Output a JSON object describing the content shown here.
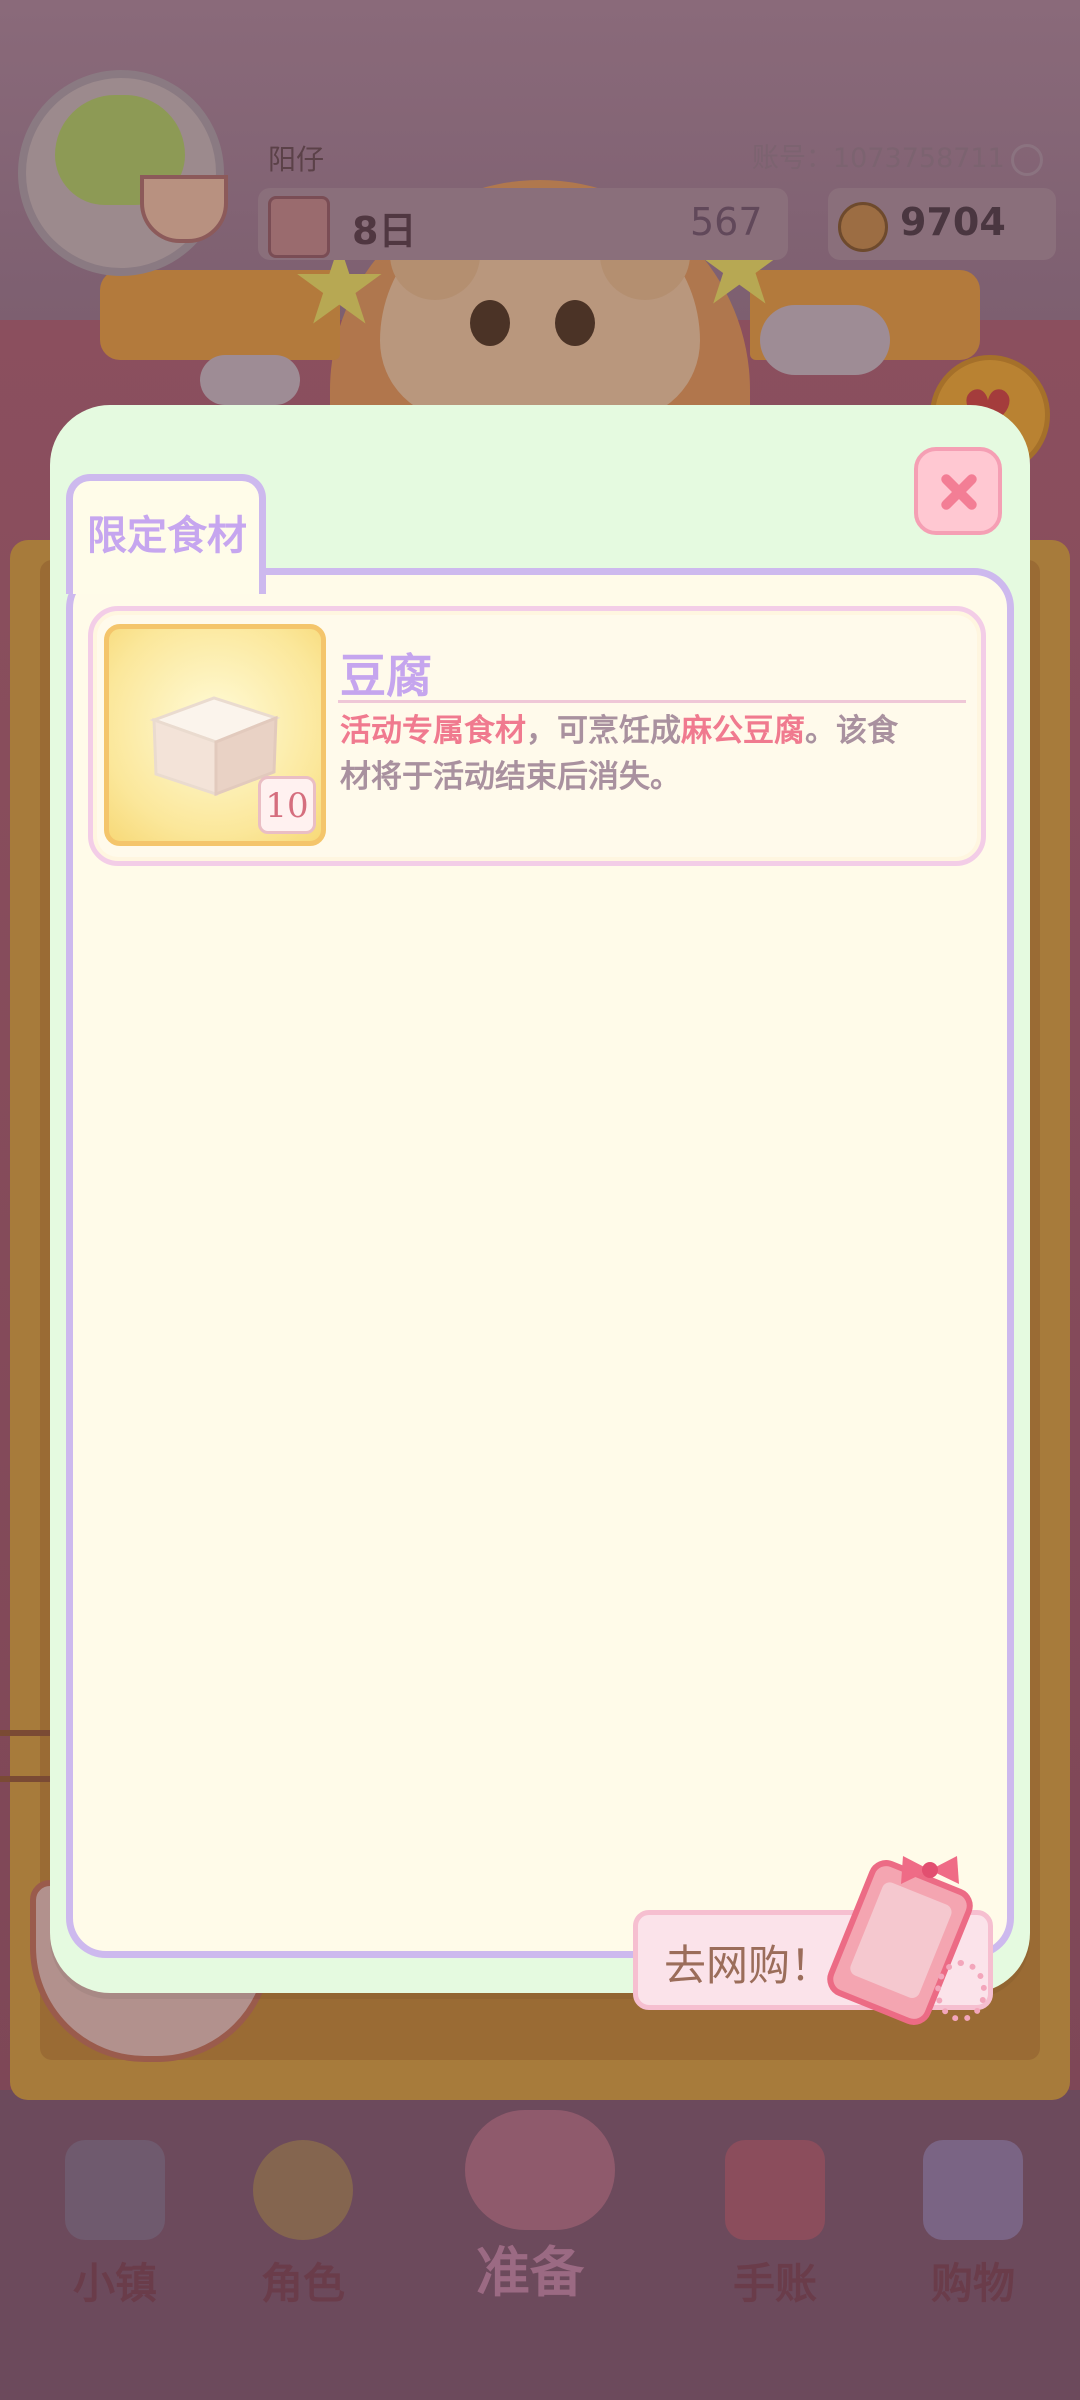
{
  "header": {
    "player_name": "阳仔",
    "account": "账号：1073758711",
    "day": "8日",
    "middle_value": "567",
    "coins": "9704"
  },
  "modal": {
    "tab_label": "限定食材",
    "close_icon": "close-icon",
    "item": {
      "name": "豆腐",
      "quantity": "10",
      "desc_highlight_1": "活动专属食材",
      "desc_text_1": "，可烹饪成",
      "desc_highlight_2": "麻公豆腐",
      "desc_text_2": "。该食材将于活动结束后消失。"
    },
    "shop_button": "去网购！"
  },
  "nav": {
    "items": [
      {
        "label": "小镇",
        "icon": "map-icon"
      },
      {
        "label": "角色",
        "icon": "character-icon"
      },
      {
        "label": "准备",
        "icon": "prepare-icon"
      },
      {
        "label": "手账",
        "icon": "journal-icon"
      },
      {
        "label": "购物",
        "icon": "shopping-bag-icon"
      }
    ]
  },
  "colors": {
    "accent_lavender": "#cdb9ee",
    "highlight_pink": "#f07a8f",
    "modal_bg": "#e5fae0",
    "panel_bg": "#fffbe9"
  }
}
